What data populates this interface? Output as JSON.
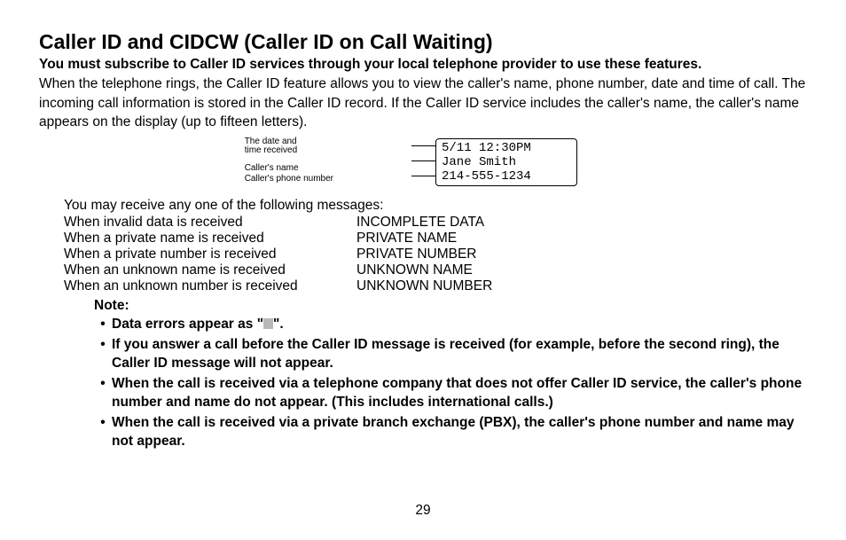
{
  "title": "Caller ID and CIDCW (Caller ID on Call Waiting)",
  "intro_bold": "You must subscribe to Caller ID services through your local telephone provider to use these features.",
  "intro_body": "When the telephone rings, the Caller ID feature allows you to view the caller's name, phone number, date and time of call. The incoming call information is stored in the Caller ID record. If the Caller ID service includes the caller's name, the caller's name appears on the display (up to fifteen letters).",
  "diagram": {
    "label_datetime_1": "The date and",
    "label_datetime_2": "time received",
    "label_name": "Caller's name",
    "label_number": "Caller's phone number",
    "lcd_line1": "5/11 12:30PM",
    "lcd_line2": "Jane Smith",
    "lcd_line3": "214-555-1234"
  },
  "messages_intro": "You may receive any one of the following messages:",
  "messages": [
    {
      "cond": "When invalid data is received",
      "val": "INCOMPLETE DATA"
    },
    {
      "cond": "When a private name is received",
      "val": "PRIVATE NAME"
    },
    {
      "cond": "When a private number is received",
      "val": "PRIVATE NUMBER"
    },
    {
      "cond": "When an unknown name is received",
      "val": "UNKNOWN NAME"
    },
    {
      "cond": "When an unknown number is received",
      "val": "UNKNOWN NUMBER"
    }
  ],
  "note_title": "Note:",
  "notes": {
    "n0a": "Data errors appear as \"",
    "n0b": "\".",
    "n1": "If you answer a call before the Caller ID message is received (for example, before the second ring), the Caller ID message will not appear.",
    "n2": "When the call is received via a telephone company that does not offer Caller ID service, the caller's phone number and name do not appear. (This includes international calls.)",
    "n3": "When the call is received via a private branch exchange (PBX), the caller's phone number and name may not appear."
  },
  "page_number": "29"
}
